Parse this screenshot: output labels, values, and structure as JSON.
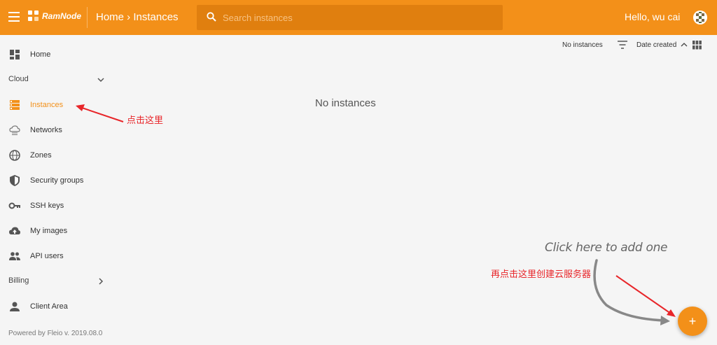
{
  "header": {
    "logo_text": "RamNode",
    "breadcrumb": "Home › Instances",
    "search_placeholder": "Search instances",
    "greeting": "Hello, wu cai"
  },
  "sidebar": {
    "items": [
      {
        "label": "Home",
        "icon": "dashboard-icon"
      },
      {
        "label": "Instances",
        "icon": "server-icon",
        "active": true
      },
      {
        "label": "Networks",
        "icon": "cloud-network-icon"
      },
      {
        "label": "Zones",
        "icon": "globe-icon"
      },
      {
        "label": "Security groups",
        "icon": "shield-icon"
      },
      {
        "label": "SSH keys",
        "icon": "key-icon"
      },
      {
        "label": "My images",
        "icon": "cloud-upload-icon"
      },
      {
        "label": "API users",
        "icon": "group-icon"
      },
      {
        "label": "Client Area",
        "icon": "person-icon"
      }
    ],
    "sections": {
      "cloud": "Cloud",
      "billing": "Billing"
    },
    "powered_by": "Powered by Fleio v. 2019.08.0"
  },
  "toolbar": {
    "count_text": "No instances",
    "sort_label": "Date created"
  },
  "main": {
    "empty_message": "No instances"
  },
  "annotations": {
    "click_here": "点击这里",
    "click_again": "再点击这里创建云服务器",
    "hint": "Click here to add one"
  },
  "fab": {
    "label": "+"
  },
  "colors": {
    "accent": "#f39019",
    "annotation_red": "#e8262a"
  }
}
